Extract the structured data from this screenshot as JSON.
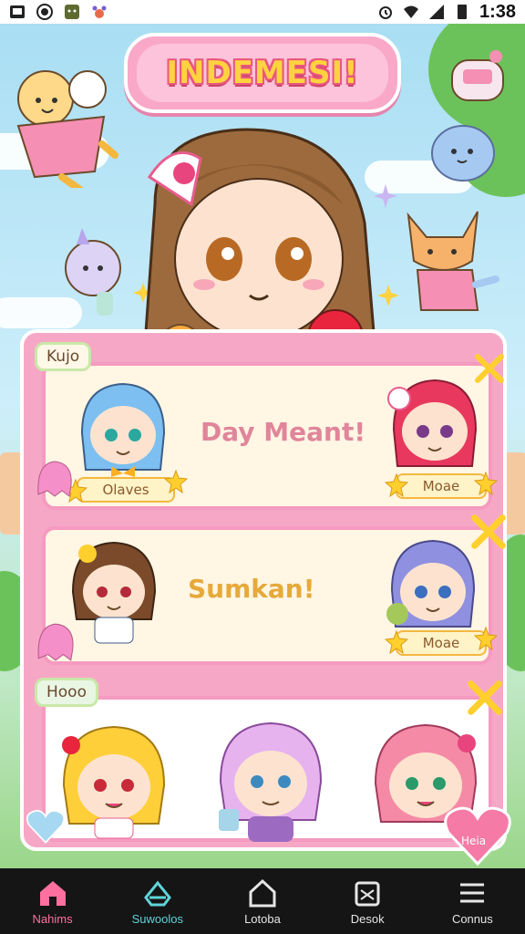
{
  "status_bar": {
    "time": "1:38",
    "icons": [
      "gallery-icon",
      "record-icon",
      "android-icon",
      "paw-icon",
      "alarm-icon",
      "wifi-icon",
      "signal-icon",
      "battery-icon"
    ]
  },
  "header": {
    "title": "INDEMESI!"
  },
  "cards": [
    {
      "tag": "Kujo",
      "headline": "Day Meant!",
      "left_name": "Olaves",
      "right_name": "Moae",
      "headline_color": "#e0859a"
    },
    {
      "tag": "",
      "headline": "Sumkan!",
      "left_name": "",
      "right_name": "Moae",
      "headline_color": "#e6a93a"
    },
    {
      "tag": "Hooo",
      "headline": "",
      "heart_label": "Heia"
    }
  ],
  "bottom_nav": {
    "items": [
      {
        "label": "Nahims",
        "icon": "home-icon",
        "color": "#ff6fa0",
        "active": true
      },
      {
        "label": "Suwoolos",
        "icon": "crown-icon",
        "color": "#5fd4d9",
        "active": false
      },
      {
        "label": "Lotoba",
        "icon": "house-outline-icon",
        "color": "#e6e6e6",
        "active": false
      },
      {
        "label": "Desok",
        "icon": "shop-icon",
        "color": "#e6e6e6",
        "active": false
      },
      {
        "label": "Connus",
        "icon": "menu-icon",
        "color": "#e6e6e6",
        "active": false
      }
    ]
  },
  "colors": {
    "accent_pink": "#f7a7c6",
    "title_yellow": "#ffd23f",
    "sky": "#bfe6f5"
  }
}
